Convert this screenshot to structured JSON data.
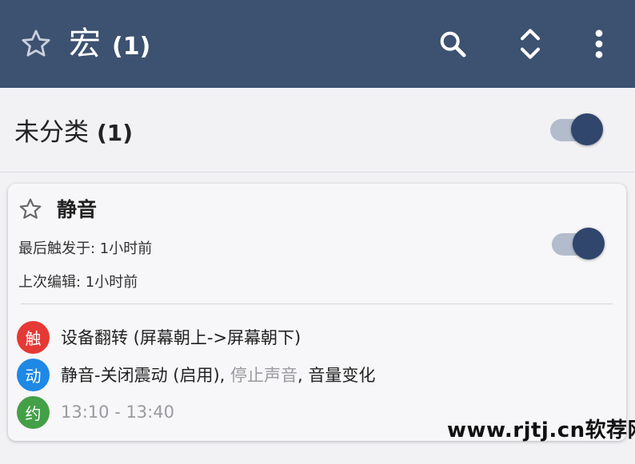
{
  "appbar": {
    "title": "宏",
    "count": "(1)",
    "icons": [
      "star-outline-icon",
      "search-icon",
      "sort-icon",
      "more-vert-icon"
    ],
    "background": "#3d5170"
  },
  "category": {
    "label": "未分类",
    "count": "(1)",
    "enabled": true
  },
  "macro": {
    "name": "静音",
    "last_triggered": "最后触发于: 1小时前",
    "last_edited": "上次编辑: 1小时前",
    "enabled": true,
    "trigger": {
      "badge": "触",
      "badge_color": "#e53935",
      "text": "设备翻转 (屏幕朝上->屏幕朝下)"
    },
    "actions": {
      "badge": "动",
      "badge_color": "#1e88e5",
      "part1": "静音-关闭震动 (启用)",
      "sep1": ", ",
      "part2": "停止声音",
      "sep2": ", ",
      "part3": "音量变化"
    },
    "constraint": {
      "badge": "约",
      "badge_color": "#43a047",
      "text": "13:10 - 13:40"
    }
  },
  "watermark": "www.rjtj.cn软荐网",
  "accent": "#30466d"
}
